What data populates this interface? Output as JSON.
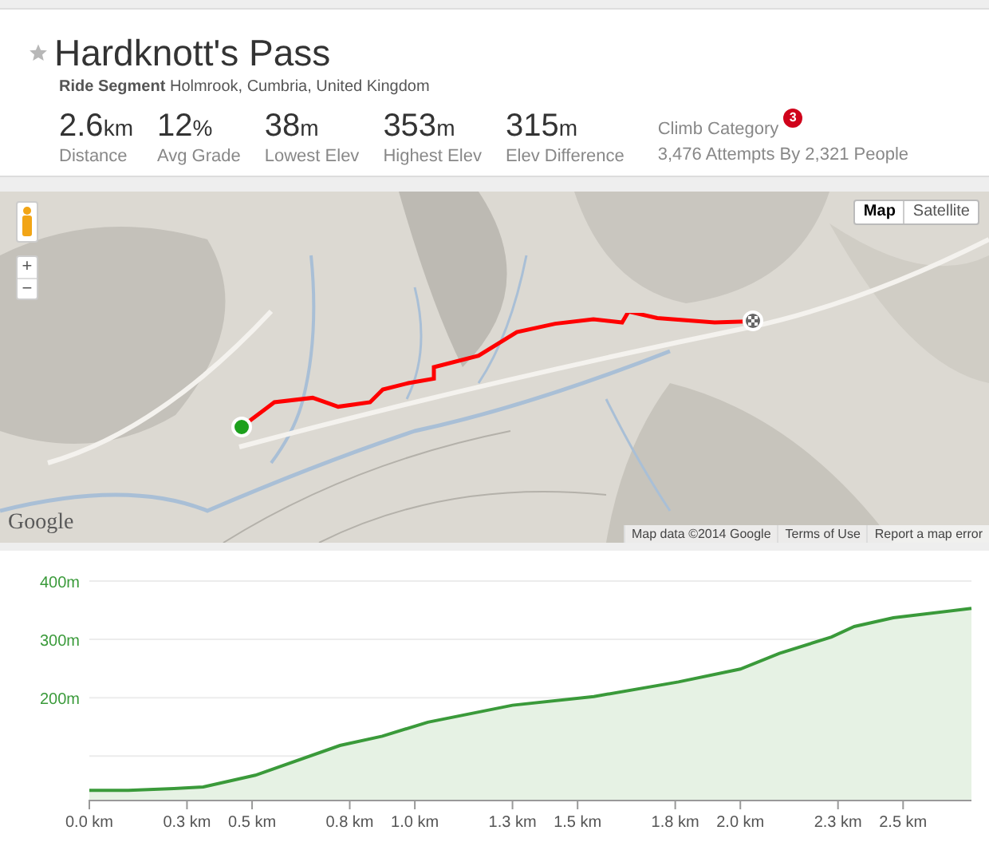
{
  "segment": {
    "title": "Hardknott's Pass",
    "starred": false,
    "type": "Ride Segment",
    "location": "Holmrook, Cumbria, United Kingdom"
  },
  "stats": [
    {
      "value": "2.6",
      "unit": "km",
      "label": "Distance"
    },
    {
      "value": "12",
      "unit": "%",
      "label": "Avg Grade"
    },
    {
      "value": "38",
      "unit": "m",
      "label": "Lowest Elev"
    },
    {
      "value": "353",
      "unit": "m",
      "label": "Highest Elev"
    },
    {
      "value": "315",
      "unit": "m",
      "label": "Elev Difference"
    }
  ],
  "climb": {
    "label": "Climb Category",
    "category": "3",
    "attempts": "3,476 Attempts By 2,321 People"
  },
  "map": {
    "kind": "picture",
    "map_types": [
      {
        "label": "Map",
        "selected": true
      },
      {
        "label": "Satellite",
        "selected": false
      }
    ],
    "zoom_in": "+",
    "zoom_out": "−",
    "logo": "Google",
    "footer_links": [
      "Map data ©2014 Google",
      "Terms of Use",
      "Report a map error"
    ]
  },
  "elevation": {
    "chart_data": {
      "type": "area",
      "x": [
        0,
        0.12,
        0.26,
        0.35,
        0.51,
        0.77,
        0.9,
        1.04,
        1.3,
        1.55,
        1.81,
        2.0,
        2.12,
        2.28,
        2.35,
        2.47,
        2.71
      ],
      "series": [
        {
          "color": "#3a9a3a",
          "values": [
            41,
            41,
            44,
            47,
            67,
            118,
            134,
            158,
            187,
            202,
            227,
            249,
            276,
            304,
            322,
            337,
            353
          ]
        }
      ],
      "xlim": [
        0,
        2.71
      ],
      "ylim": [
        25,
        400
      ],
      "xticks": [
        {
          "value": 0,
          "label": "0.0 km"
        },
        {
          "value": 0.3,
          "label": "0.3 km"
        },
        {
          "value": 0.5,
          "label": "0.5 km"
        },
        {
          "value": 0.8,
          "label": "0.8 km"
        },
        {
          "value": 1.0,
          "label": "1.0 km"
        },
        {
          "value": 1.3,
          "label": "1.3 km"
        },
        {
          "value": 1.5,
          "label": "1.5 km"
        },
        {
          "value": 1.8,
          "label": "1.8 km"
        },
        {
          "value": 2.0,
          "label": "2.0 km"
        },
        {
          "value": 2.3,
          "label": "2.3 km"
        },
        {
          "value": 2.5,
          "label": "2.5 km"
        }
      ],
      "yticks": [
        {
          "value": 200,
          "label": "200m"
        },
        {
          "value": 300,
          "label": "300m"
        },
        {
          "value": 400,
          "label": "400m"
        }
      ]
    }
  }
}
